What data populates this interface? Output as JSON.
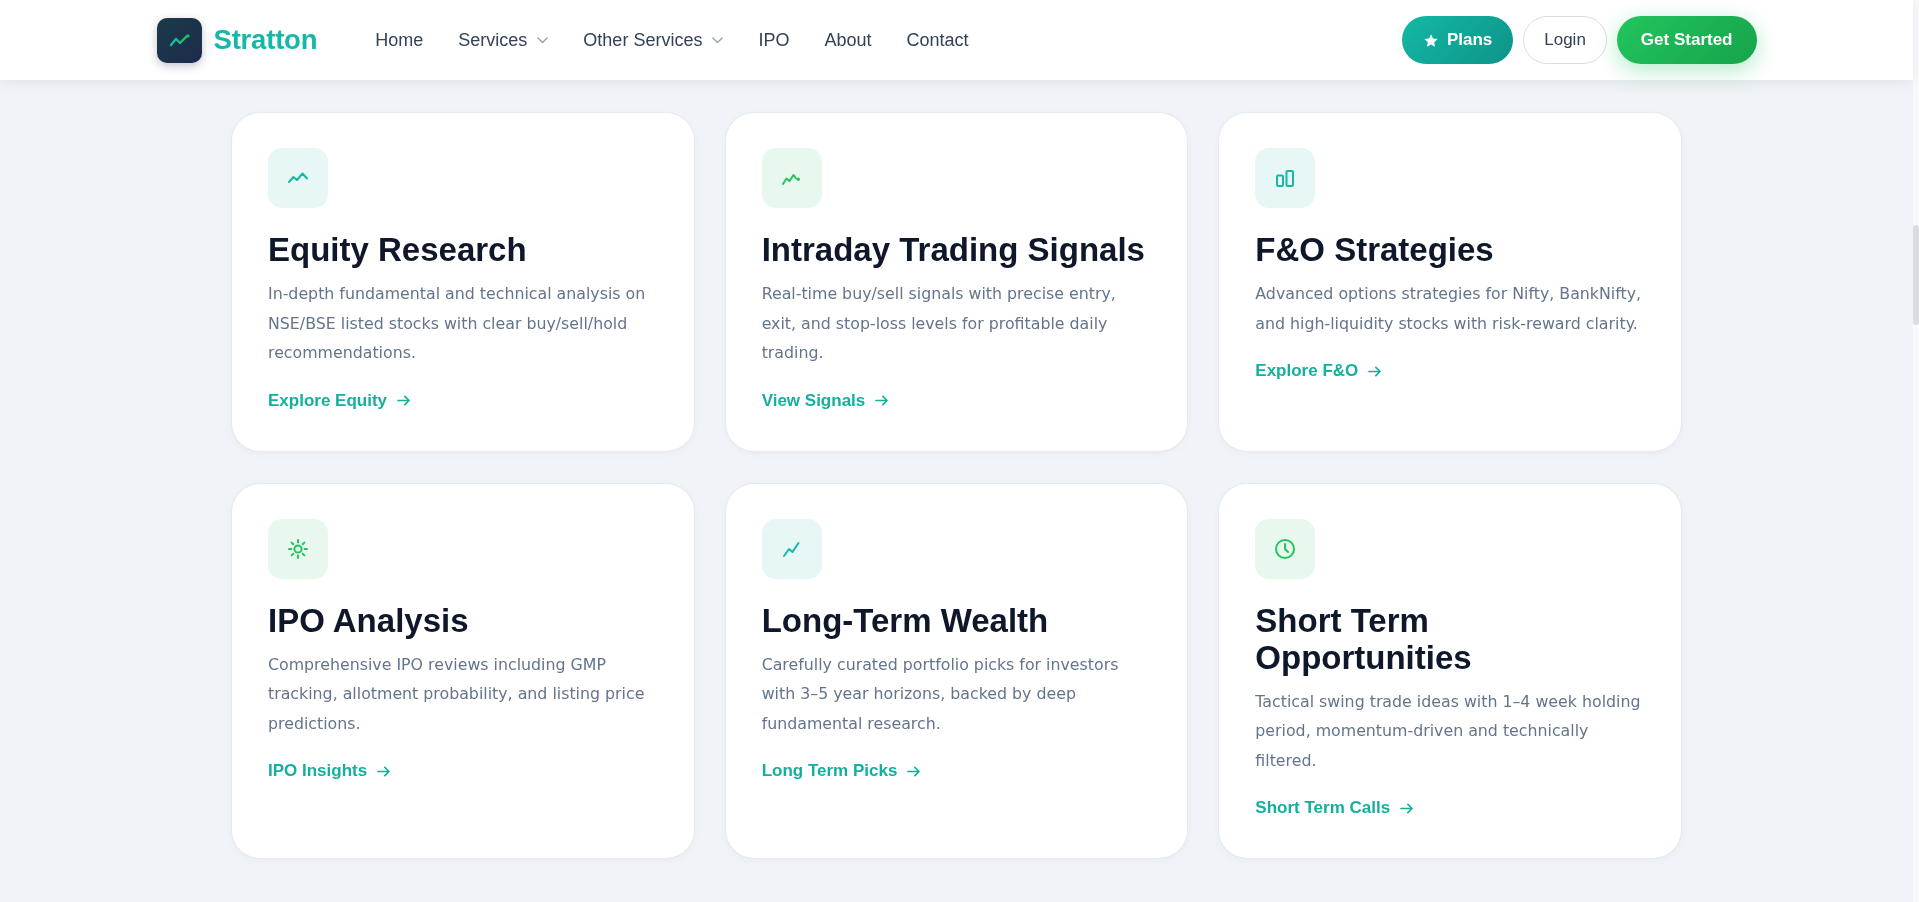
{
  "header": {
    "brand": "Stratton",
    "nav": [
      {
        "label": "Home",
        "dropdown": false
      },
      {
        "label": "Services",
        "dropdown": true
      },
      {
        "label": "Other Services",
        "dropdown": true
      },
      {
        "label": "IPO",
        "dropdown": false
      },
      {
        "label": "About",
        "dropdown": false
      },
      {
        "label": "Contact",
        "dropdown": false
      }
    ],
    "actions": [
      {
        "label": "Plans",
        "kind": "plans"
      },
      {
        "label": "Login",
        "kind": "outline"
      },
      {
        "label": "Get Started",
        "kind": "primary"
      }
    ]
  },
  "cards": [
    {
      "title": "Equity Research",
      "description": "In-depth fundamental and technical analysis on NSE/BSE listed stocks with clear buy/sell/hold recommendations.",
      "link": "Explore Equity"
    },
    {
      "title": "Intraday Trading Signals",
      "description": "Real-time buy/sell signals with precise entry, exit, and stop-loss levels for profitable daily trading.",
      "link": "View Signals"
    },
    {
      "title": "F&O Strategies",
      "description": "Advanced options strategies for Nifty, BankNifty, and high-liquidity stocks with risk-reward clarity.",
      "link": "Explore F&O"
    },
    {
      "title": "IPO Analysis",
      "description": "Comprehensive IPO reviews including GMP tracking, allotment probability, and listing price predictions.",
      "link": "IPO Insights"
    },
    {
      "title": "Long-Term Wealth",
      "description": "Carefully curated portfolio picks for investors with 3–5 year horizons, backed by deep fundamental research.",
      "link": "Long Term Picks"
    },
    {
      "title": "Short Term Opportunities",
      "description": "Tactical swing trade ideas with 1–4 week holding period, momentum-driven and technically filtered.",
      "link": "Short Term Calls"
    }
  ]
}
